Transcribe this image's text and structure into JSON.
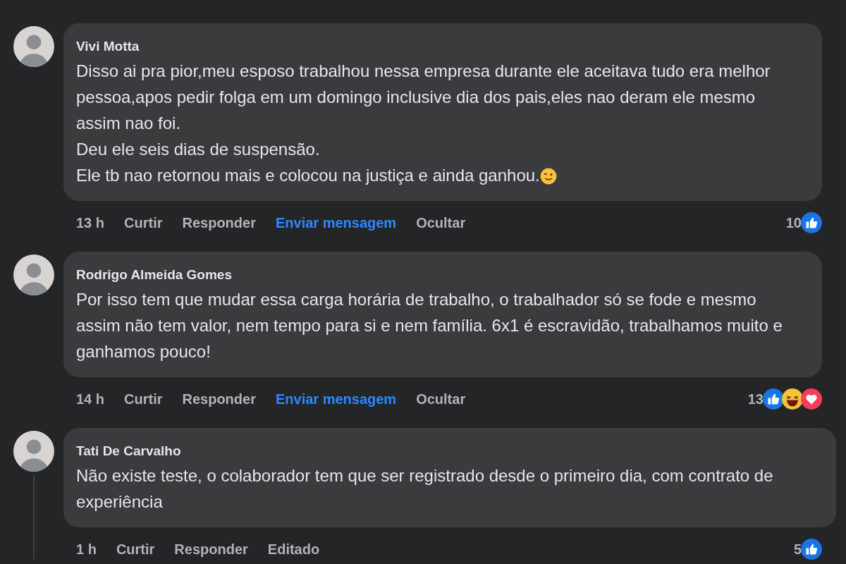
{
  "comments": [
    {
      "author": "Vivi Motta",
      "lines": [
        "Disso ai pra pior,meu esposo trabalhou nessa empresa durante ele aceitava tudo era melhor",
        "pessoa,apos pedir folga em um domingo inclusive dia dos pais,eles nao deram ele mesmo",
        "assim nao foi.",
        "Deu ele seis dias de suspensão.",
        "Ele tb nao retornou mais e colocou na justiça e ainda ganhou."
      ],
      "end_icon": {
        "kind": "wink"
      },
      "thread_line": false,
      "wide": false,
      "actions": [
        {
          "label": "13 h",
          "kind": "meta"
        },
        {
          "label": "Curtir",
          "kind": "action"
        },
        {
          "label": "Responder",
          "kind": "action"
        },
        {
          "label": "Enviar mensagem",
          "kind": "link"
        },
        {
          "label": "Ocultar",
          "kind": "action"
        }
      ],
      "reaction_count": "10",
      "reactions": [
        {
          "kind": "like"
        }
      ]
    },
    {
      "author": "Rodrigo Almeida Gomes",
      "lines": [
        "Por isso tem que mudar essa carga horária de trabalho, o trabalhador só se fode e mesmo",
        "assim não tem valor, nem tempo para si e nem família. 6x1 é escravidão, trabalhamos muito e",
        "ganhamos pouco!"
      ],
      "thread_line": false,
      "wide": false,
      "actions": [
        {
          "label": "14 h",
          "kind": "meta"
        },
        {
          "label": "Curtir",
          "kind": "action"
        },
        {
          "label": "Responder",
          "kind": "action"
        },
        {
          "label": "Enviar mensagem",
          "kind": "link"
        },
        {
          "label": "Ocultar",
          "kind": "action"
        }
      ],
      "reaction_count": "13",
      "reactions": [
        {
          "kind": "like"
        },
        {
          "kind": "haha"
        },
        {
          "kind": "love"
        }
      ]
    },
    {
      "author": "Tati De Carvalho",
      "lines": [
        "Não existe teste, o colaborador tem que ser registrado desde o primeiro dia, com contrato de",
        "experiência"
      ],
      "thread_line": true,
      "wide": true,
      "actions": [
        {
          "label": "1 h",
          "kind": "meta"
        },
        {
          "label": "Curtir",
          "kind": "action"
        },
        {
          "label": "Responder",
          "kind": "action"
        },
        {
          "label": "Editado",
          "kind": "meta"
        }
      ],
      "reaction_count": "5",
      "reactions": [
        {
          "kind": "like"
        }
      ]
    }
  ]
}
